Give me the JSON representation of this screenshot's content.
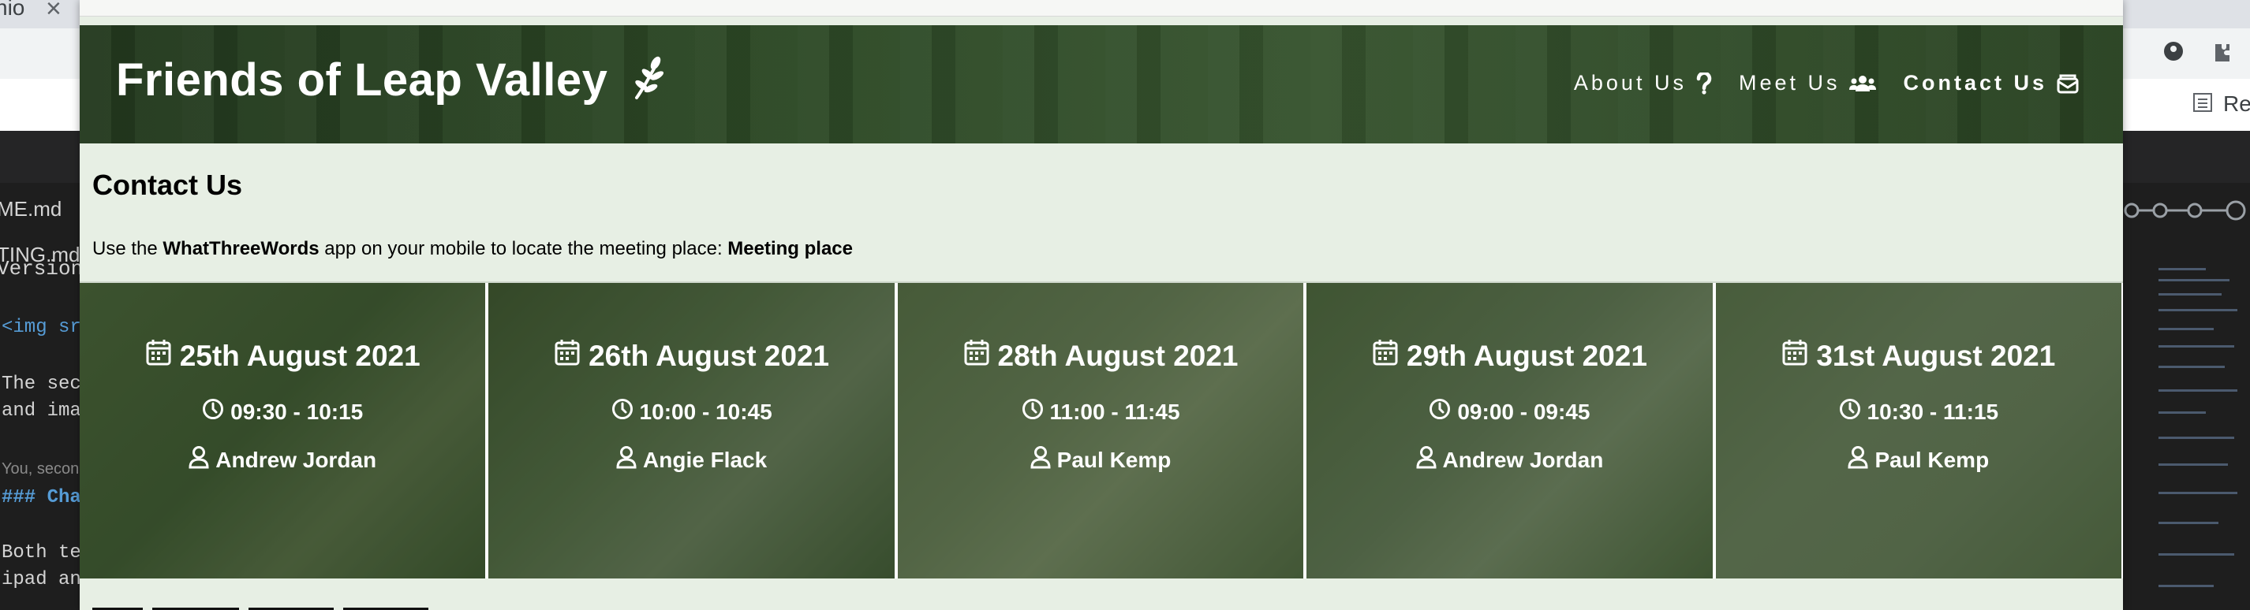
{
  "background": {
    "tab_fragment": "nio",
    "close_glyph": "×",
    "reader_label": "Re",
    "editor_files": [
      "ME.md",
      "TING.md"
    ],
    "editor_lines": [
      "Version",
      "<img sr",
      "The sec",
      "and ima",
      "You, secon",
      "### Cha",
      "Both te",
      "ipad an"
    ]
  },
  "site": {
    "title": "Friends of Leap Valley",
    "nav": [
      {
        "label": "About Us",
        "icon": "question-icon",
        "active": false
      },
      {
        "label": "Meet Us",
        "icon": "users-icon",
        "active": false
      },
      {
        "label": "Contact Us",
        "icon": "envelope-icon",
        "active": true
      }
    ],
    "contact_heading": "Contact Us",
    "instructions": {
      "prefix": "Use the ",
      "app_name": "WhatThreeWords",
      "middle": " app on your mobile to locate the meeting place: ",
      "link_text": "Meeting place"
    },
    "meetings": [
      {
        "date": "25th August 2021",
        "time": "09:30 - 10:15",
        "person": "Andrew Jordan"
      },
      {
        "date": "26th August 2021",
        "time": "10:00 - 10:45",
        "person": "Angie Flack"
      },
      {
        "date": "28th August 2021",
        "time": "11:00 - 11:45",
        "person": "Paul Kemp"
      },
      {
        "date": "29th August 2021",
        "time": "09:00 - 09:45",
        "person": "Andrew Jordan"
      },
      {
        "date": "31st August 2021",
        "time": "10:30 - 11:15",
        "person": "Paul Kemp"
      }
    ]
  }
}
